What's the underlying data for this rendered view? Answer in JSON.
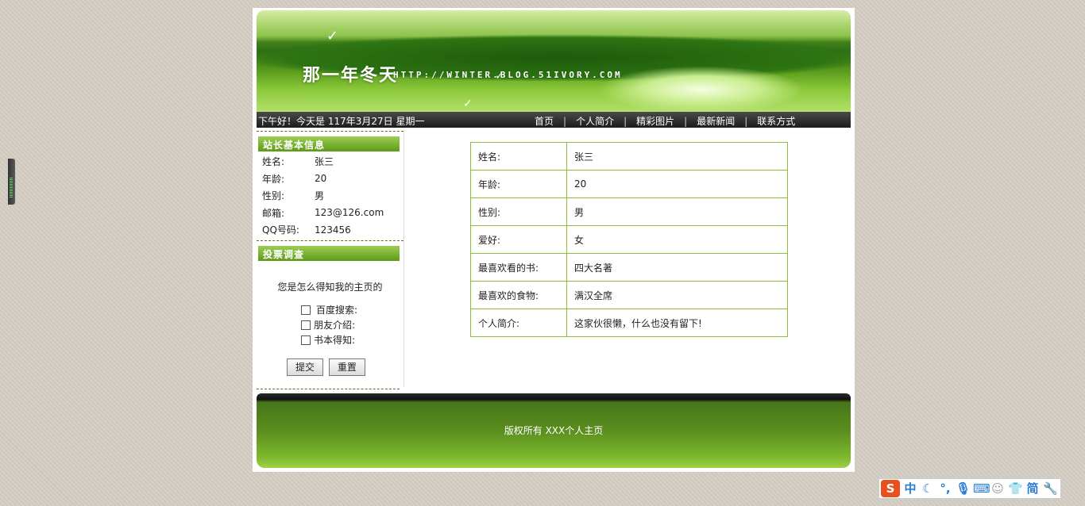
{
  "header": {
    "site_title": "那一年冬天",
    "site_url": "HTTP://WINTER.BLOG.51IVORY.COM"
  },
  "navbar": {
    "greeting": "下午好！今天是 117年3月27日 星期一",
    "links": [
      "首页",
      "个人简介",
      "精彩图片",
      "最新新闻",
      "联系方式"
    ],
    "separator": "|"
  },
  "sidebar": {
    "info_title": "站长基本信息",
    "info": [
      {
        "label": "姓名:",
        "value": "张三"
      },
      {
        "label": "年龄:",
        "value": "20"
      },
      {
        "label": "性别:",
        "value": "男"
      },
      {
        "label": "邮箱:",
        "value": "123@126.com"
      },
      {
        "label": "QQ号码:",
        "value": "123456"
      }
    ],
    "vote_title": "投票调查",
    "vote_question": "您是怎么得知我的主页的",
    "vote_options": [
      "百度搜索:",
      "朋友介绍:",
      "书本得知:"
    ],
    "submit_label": "提交",
    "reset_label": "重置"
  },
  "profile_table": [
    {
      "label": "姓名:",
      "value": "张三"
    },
    {
      "label": "年龄:",
      "value": "20"
    },
    {
      "label": "性别:",
      "value": "男"
    },
    {
      "label": "爱好:",
      "value": "女"
    },
    {
      "label": "最喜欢看的书:",
      "value": "四大名著"
    },
    {
      "label": "最喜欢的食物:",
      "value": "满汉全席"
    },
    {
      "label": "个人简介:",
      "value": "这家伙很懒，什么也没有留下!"
    }
  ],
  "footer": {
    "copyright": "版权所有 XXX个人主页"
  },
  "ime_toolbar": {
    "logo": "S",
    "mode": "中",
    "simplified": "简"
  }
}
